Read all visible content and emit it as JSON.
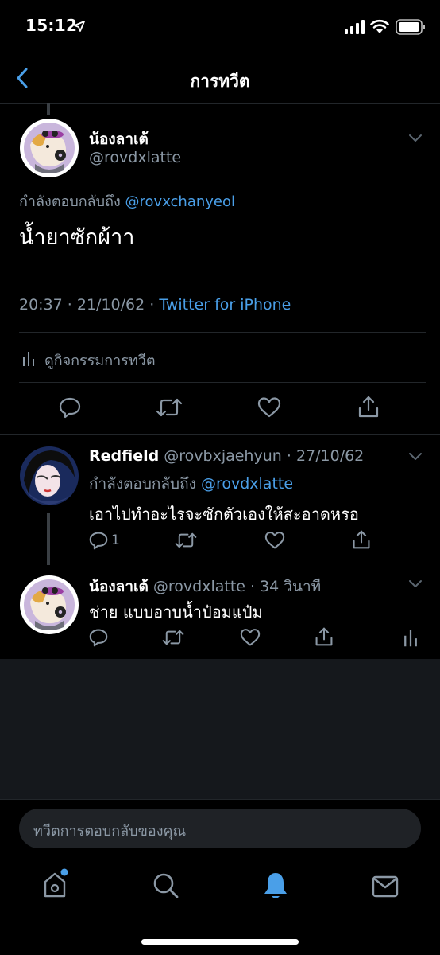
{
  "status_bar": {
    "time": "15:12"
  },
  "nav": {
    "title": "การทวีต"
  },
  "main_tweet": {
    "name": "น้องลาเต้",
    "handle": "@rovdxlatte",
    "reply_prefix": "กำลังตอบกลับถึง",
    "reply_to": "@rovxchanyeol",
    "text": "น้ำยาซักผ้าา",
    "timestamp": "20:37 · 21/10/62 ·",
    "source": "Twitter for iPhone",
    "activity_label": "ดูกิจกรรมการทวีต"
  },
  "replies": [
    {
      "name": "Redfield",
      "handle": "@rovbxjaehyun",
      "date": "· 27/10/62",
      "reply_prefix": "กำลังตอบกลับถึง",
      "reply_to": "@rovdxlatte",
      "text": "เอาไปทำอะไรจะซักตัวเองให้สะอาดหรอ",
      "reply_count": "1"
    },
    {
      "name": "น้องลาเต้",
      "handle": "@rovdxlatte",
      "date": "· 34 วินาที",
      "text": "ช่าย แบบอาบน้ำป๋อมแป๋ม"
    }
  ],
  "composer": {
    "placeholder": "ทวีตการตอบกลับของคุณ"
  },
  "tabs": [
    "home-icon",
    "search-icon",
    "notifications-icon",
    "messages-icon"
  ],
  "colors": {
    "accent": "#4a9fe8",
    "muted": "#8b98a5",
    "background": "#000000"
  }
}
